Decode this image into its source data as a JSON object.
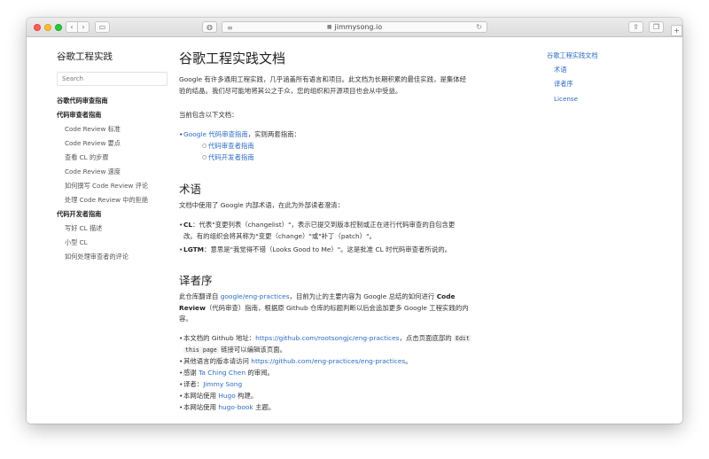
{
  "browser": {
    "address": "jimmysong.io"
  },
  "sidebar": {
    "site_title": "谷歌工程实践",
    "search_placeholder": "Search",
    "items": [
      {
        "label": "谷歌代码审查指南",
        "bold": true
      },
      {
        "label": "代码审查者指南",
        "bold": true
      },
      {
        "label": "Code Review 标准",
        "bold": false
      },
      {
        "label": "Code Review 要点",
        "bold": false
      },
      {
        "label": "查看 CL 的步骤",
        "bold": false
      },
      {
        "label": "Code Review 速度",
        "bold": false
      },
      {
        "label": "如何撰写 Code Review 评论",
        "bold": false
      },
      {
        "label": "处理 Code Review 中的拒绝",
        "bold": false
      },
      {
        "label": "代码开发者指南",
        "bold": true
      },
      {
        "label": "写好 CL 描述",
        "bold": false
      },
      {
        "label": "小型 CL",
        "bold": false
      },
      {
        "label": "如何处理审查者的评论",
        "bold": false
      }
    ]
  },
  "main": {
    "title": "谷歌工程实践文档",
    "intro_line1": "Google 有许多通用工程实践，几乎涵盖所有语言和项目。此文档为长期积累的最佳实践，是集体经",
    "intro_line2": "验的结晶。我们尽可能地将其公之于众，您的组织和开源项目也会从中受益。",
    "current_docs": "当前包含以下文档：",
    "doc_list": {
      "guide_link": "Google 代码审查指南",
      "guide_suffix": "，实则两套指南：",
      "sub1": "代码审查者指南",
      "sub2": "代码开发者指南"
    },
    "terms_heading": "术语",
    "terms_intro": "文档中使用了 Google 内部术语，在此为外部读者澄清：",
    "terms": {
      "cl_term": "CL",
      "cl_text_1": "：代表\"变更列表（changelist）\"，表示已提交到版本控制或正在进行代码审查的自包含更",
      "cl_text_2": "改。有的组织会将其称为\"变更（change）\"或\"补丁（patch）\"。",
      "lgtm_term": "LGTM",
      "lgtm_text": "：意思是\"我觉得不错（Looks Good to Me）\"。这是批准 CL 时代码审查者所说的。"
    },
    "translator_heading": "译者序",
    "translator_p_1a": "此仓库翻译自 ",
    "translator_p_link": "google/eng-practices",
    "translator_p_1b": "，目前为止的主要内容为 Google 总结的如何进行 ",
    "translator_p_bold": "Code",
    "translator_p_2a": "Review",
    "translator_p_2b": "（代码审查）指南，根据原 Github 仓库的标题判断以后会追加更多 Google 工程实践的内",
    "translator_p_3": "容。",
    "bullets": {
      "b1_pre": "本文档的 Github 地址：",
      "b1_link": "https://github.com/rootsongjc/eng-practices",
      "b1_mid": "，点击页面底部的 ",
      "b1_code1": "Edit",
      "b1_code2": "this page",
      "b1_post": " 链接可以编辑该页面。",
      "b2_pre": "其他语言的版本请访问 ",
      "b2_link": "https://github.com/eng-practices/eng-practices",
      "b2_post": "。",
      "b3_pre": "感谢 ",
      "b3_link": "Ta Ching Chen",
      "b3_post": " 的审阅。",
      "b4_pre": "译者：",
      "b4_link": "Jimmy Song",
      "b5_pre": "本网站使用 ",
      "b5_link": "Hugo",
      "b5_post": " 构建。",
      "b6_pre": "本网站使用 ",
      "b6_link": "hugo-book",
      "b6_post": " 主题。"
    }
  },
  "toc": {
    "items": [
      "谷歌工程实践文档",
      "术语",
      "译者序",
      "License"
    ]
  }
}
